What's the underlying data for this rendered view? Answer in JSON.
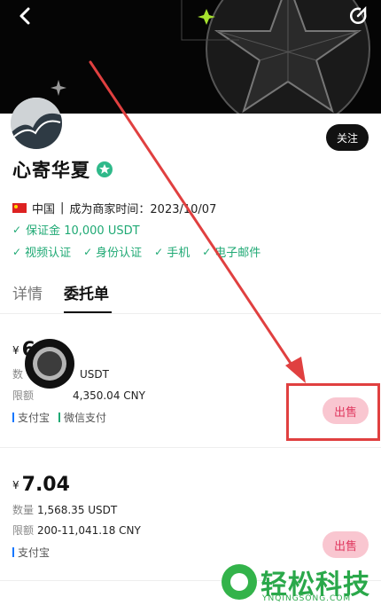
{
  "merchant": {
    "name": "心寄华夏",
    "follow_label": "关注",
    "country": "中国",
    "merchant_since": "成为商家时间：2023/10/07",
    "deposit": "保证金 10,000 USDT",
    "verifications": [
      "视频认证",
      "身份认证",
      "手机",
      "电子邮件"
    ]
  },
  "tabs": {
    "details": "详情",
    "orders": "委托单"
  },
  "orders": [
    {
      "currency": "¥",
      "price": "6",
      "amount_label": "数",
      "amount_value": "USDT",
      "limit_label": "限额",
      "limit_value": "4,350.04 CNY",
      "payments": [
        "支付宝",
        "微信支付"
      ],
      "action": "出售"
    },
    {
      "currency": "¥",
      "price": "7.04",
      "amount_label": "数量",
      "amount_value": "1,568.35 USDT",
      "limit_label": "限额",
      "limit_value": "200-11,041.18 CNY",
      "payments": [
        "支付宝"
      ],
      "action": "出售"
    }
  ],
  "colors": {
    "green": "#1fa974",
    "sell_bg": "#f9c6d0",
    "sell_text": "#e03960",
    "annotation_red": "#e04040"
  },
  "watermark": {
    "title": "轻松科技",
    "subtitle": "YNQINGSONG.COM"
  }
}
